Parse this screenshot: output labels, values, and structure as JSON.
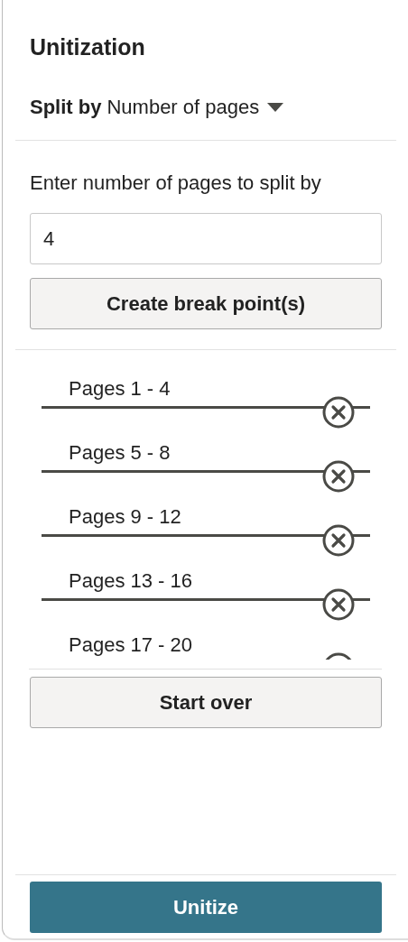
{
  "panel": {
    "title": "Unitization"
  },
  "split_by": {
    "label": "Split by",
    "value": "Number of pages"
  },
  "pages_field": {
    "label": "Enter number of pages to split by",
    "value": "4"
  },
  "create_button": "Create break point(s)",
  "break_points": [
    {
      "label": "Pages 1 - 4"
    },
    {
      "label": "Pages 5 - 8"
    },
    {
      "label": "Pages 9 - 12"
    },
    {
      "label": "Pages 13 - 16"
    },
    {
      "label": "Pages 17 - 20"
    }
  ],
  "start_over_button": "Start over",
  "unitize_button": "Unitize"
}
